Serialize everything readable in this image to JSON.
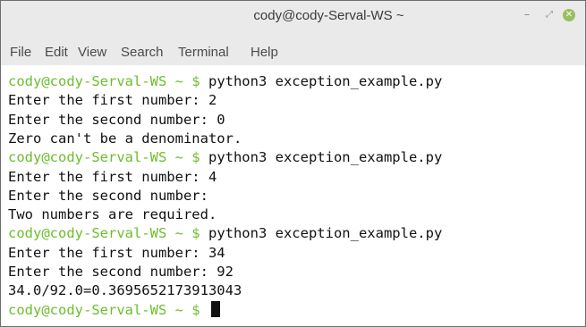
{
  "window": {
    "title": "cody@cody-Serval-WS ~",
    "minimize_glyph": "–",
    "maximize_glyph": "⤢",
    "close_glyph": "✕"
  },
  "menu": {
    "items": [
      {
        "label": "File"
      },
      {
        "label": "Edit"
      },
      {
        "label": "View"
      },
      {
        "label": "Search"
      },
      {
        "label": "Terminal"
      },
      {
        "label": "Help"
      }
    ]
  },
  "terminal": {
    "prompt": "cody@cody-Serval-WS ~ $",
    "lines": [
      {
        "type": "prompt",
        "command": "python3 exception_example.py"
      },
      {
        "type": "output",
        "text": "Enter the first number: 2"
      },
      {
        "type": "output",
        "text": "Enter the second number: 0"
      },
      {
        "type": "output",
        "text": "Zero can't be a denominator."
      },
      {
        "type": "prompt",
        "command": "python3 exception_example.py"
      },
      {
        "type": "output",
        "text": "Enter the first number: 4"
      },
      {
        "type": "output",
        "text": "Enter the second number:"
      },
      {
        "type": "output",
        "text": "Two numbers are required."
      },
      {
        "type": "prompt",
        "command": "python3 exception_example.py"
      },
      {
        "type": "output",
        "text": "Enter the first number: 34"
      },
      {
        "type": "output",
        "text": "Enter the second number: 92"
      },
      {
        "type": "output",
        "text": "34.0/92.0=0.3695652173913043"
      },
      {
        "type": "prompt",
        "command": ""
      }
    ]
  },
  "colors": {
    "prompt": "#6cbe2c",
    "close_button": "#97bf60",
    "titlebar": "#eaeaea"
  }
}
